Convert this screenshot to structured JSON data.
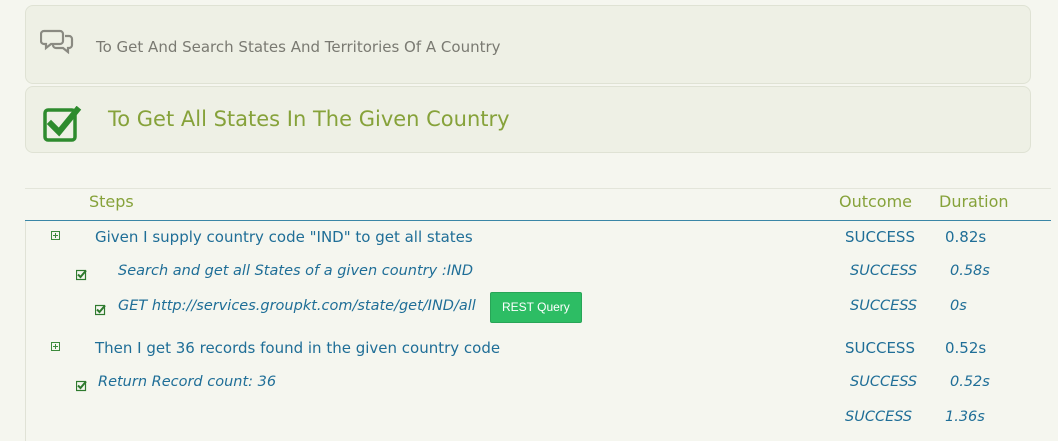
{
  "story": {
    "icon": "comments-icon",
    "title": "To Get And Search States And Territories Of A Country"
  },
  "scenario": {
    "icon": "checked-box-icon",
    "title": "To Get All States In The Given Country",
    "status_color": "#2e8b2e"
  },
  "table": {
    "headers": {
      "steps": "Steps",
      "outcome": "Outcome",
      "duration": "Duration"
    },
    "rows": [
      {
        "text": "Given I supply country code \"IND\" to get all states",
        "outcome": "SUCCESS",
        "duration": "0.82s"
      },
      {
        "text": "Search and get all States of a given country :IND",
        "outcome": "SUCCESS",
        "duration": "0.58s"
      },
      {
        "text": "GET http://services.groupkt.com/state/get/IND/all",
        "outcome": "SUCCESS",
        "duration": "0s",
        "button": "REST Query"
      },
      {
        "text": "Then I get 36 records found in the given country code",
        "outcome": "SUCCESS",
        "duration": "0.52s"
      },
      {
        "text": "Return Record count: 36",
        "outcome": "SUCCESS",
        "duration": "0.52s"
      },
      {
        "text": "",
        "outcome": "SUCCESS",
        "duration": "1.36s"
      }
    ]
  },
  "colors": {
    "accent": "#86a23a",
    "link": "#1f6e97",
    "button": "#2dbd64"
  }
}
